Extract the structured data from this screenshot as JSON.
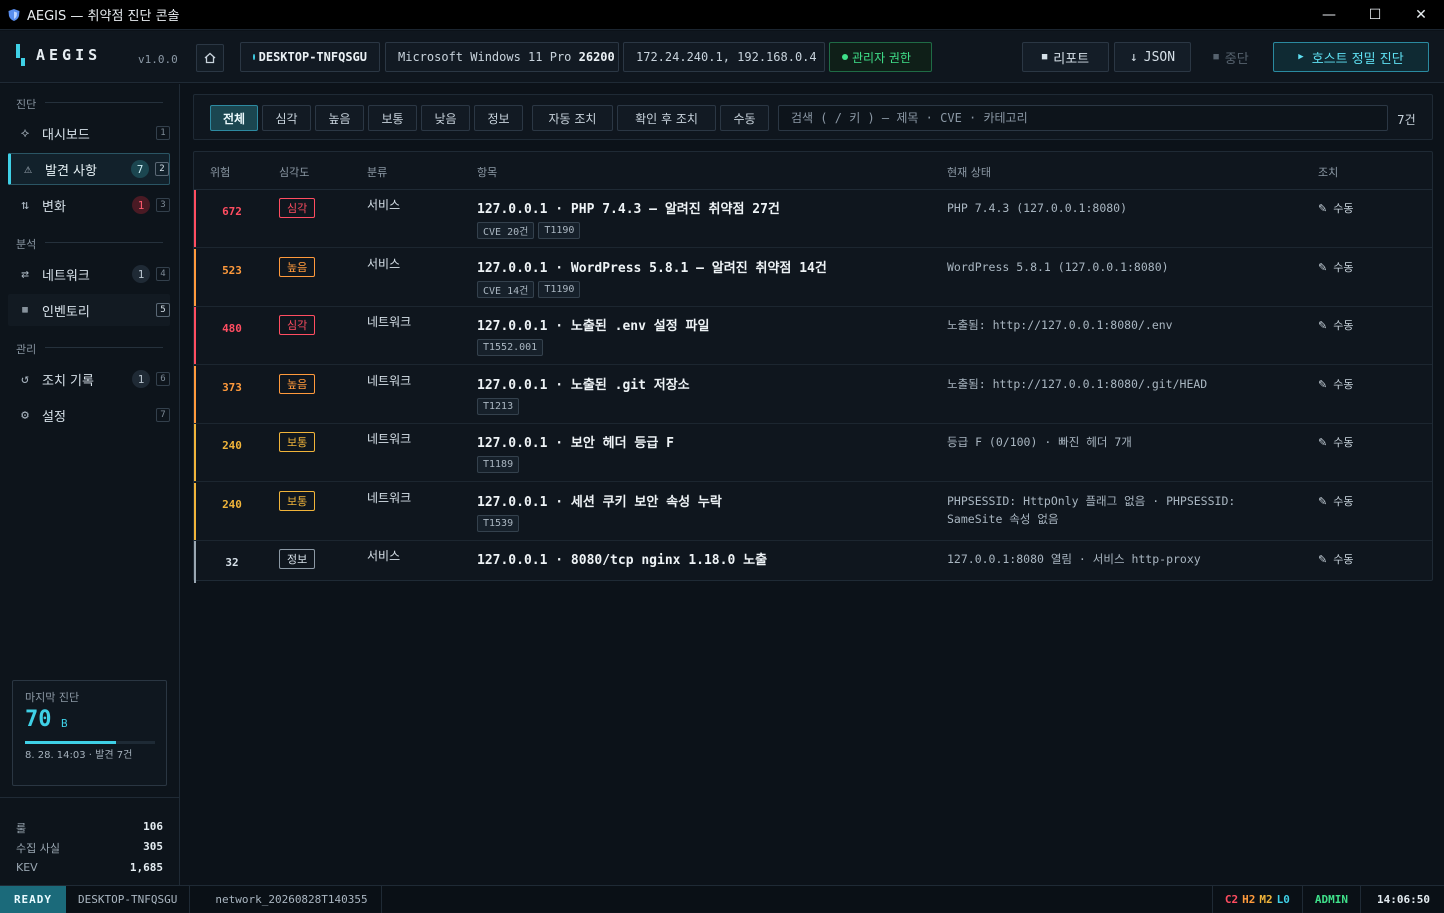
{
  "window": {
    "title": "AEGIS — 취약점 진단 콘솔",
    "minimize": "—",
    "maximize": "☐",
    "close": "✕"
  },
  "header": {
    "brand": "AEGIS",
    "version": "v1.0.0",
    "host": "DESKTOP-TNFQSGU",
    "os_name": "Microsoft Windows 11 Pro",
    "os_build": "26200",
    "ips": "172.24.240.1, 192.168.0.4",
    "admin": "관리자 권한",
    "report_button": "리포트",
    "json_button": "JSON",
    "stop_button": "중단",
    "scan_button": "호스트 정밀 진단"
  },
  "sidebar": {
    "sections": [
      {
        "label": "진단"
      },
      {
        "label": "분석"
      },
      {
        "label": "관리"
      }
    ],
    "items": [
      {
        "label": "대시보드",
        "icon": "diamond-icon",
        "count": "",
        "key": "1"
      },
      {
        "label": "발견 사항",
        "icon": "warning-icon",
        "count": "7",
        "key": "2"
      },
      {
        "label": "변화",
        "icon": "arrows-updown-icon",
        "count": "1",
        "key": "3"
      },
      {
        "label": "네트워크",
        "icon": "arrows-swap-icon",
        "count": "1",
        "key": "4"
      },
      {
        "label": "인벤토리",
        "icon": "inventory-icon",
        "count": "",
        "key": "5"
      },
      {
        "label": "조치 기록",
        "icon": "history-icon",
        "count": "1",
        "key": "6"
      },
      {
        "label": "설정",
        "icon": "gear-icon",
        "count": "",
        "key": "7"
      }
    ],
    "last_scan": {
      "title": "마지막 진단",
      "score": "70",
      "grade": "B",
      "progress": 0.7,
      "meta": "8. 28. 14:03 · 발견 7건"
    },
    "stats": [
      {
        "label": "룰",
        "value": "106"
      },
      {
        "label": "수집 사실",
        "value": "305"
      },
      {
        "label": "KEV",
        "value": "1,685"
      }
    ]
  },
  "filters": {
    "tabs": [
      "전체",
      "심각",
      "높음",
      "보통",
      "낮음",
      "정보",
      "자동 조치",
      "확인 후 조치",
      "수동"
    ],
    "active": 0,
    "search_placeholder": "검색 ( / 키 ) — 제목 · CVE · 카테고리",
    "count": "7건"
  },
  "table": {
    "headers": {
      "risk": "위험",
      "severity": "심각도",
      "category": "분류",
      "item": "항목",
      "status": "현재 상태",
      "action": "조치"
    },
    "rows": [
      {
        "risk": "672",
        "severity": "심각",
        "level": "critical",
        "category": "서비스",
        "title": "127.0.0.1 · PHP 7.4.3 — 알려진 취약점 27건",
        "tags": [
          "CVE 20건",
          "T1190"
        ],
        "status": "PHP 7.4.3 (127.0.0.1:8080)",
        "action": "수동"
      },
      {
        "risk": "523",
        "severity": "높음",
        "level": "high",
        "category": "서비스",
        "title": "127.0.0.1 · WordPress 5.8.1 — 알려진 취약점 14건",
        "tags": [
          "CVE 14건",
          "T1190"
        ],
        "status": "WordPress 5.8.1 (127.0.0.1:8080)",
        "action": "수동"
      },
      {
        "risk": "480",
        "severity": "심각",
        "level": "critical",
        "category": "네트워크",
        "title": "127.0.0.1 · 노출된 .env 설정 파일",
        "tags": [
          "T1552.001"
        ],
        "status": "노출됨: http://127.0.0.1:8080/.env",
        "action": "수동"
      },
      {
        "risk": "373",
        "severity": "높음",
        "level": "high",
        "category": "네트워크",
        "title": "127.0.0.1 · 노출된 .git 저장소",
        "tags": [
          "T1213"
        ],
        "status": "노출됨: http://127.0.0.1:8080/.git/HEAD",
        "action": "수동"
      },
      {
        "risk": "240",
        "severity": "보통",
        "level": "medium",
        "category": "네트워크",
        "title": "127.0.0.1 · 보안 헤더 등급 F",
        "tags": [
          "T1189"
        ],
        "status": "등급 F (0/100) · 빠진 헤더 7개",
        "action": "수동"
      },
      {
        "risk": "240",
        "severity": "보통",
        "level": "medium",
        "category": "네트워크",
        "title": "127.0.0.1 · 세션 쿠키 보안 속성 누락",
        "tags": [
          "T1539"
        ],
        "status": "PHPSESSID: HttpOnly 플래그 없음 · PHPSESSID: SameSite 속성 없음",
        "action": "수동"
      },
      {
        "risk": "32",
        "severity": "정보",
        "level": "info",
        "category": "서비스",
        "title": "127.0.0.1 · 8080/tcp nginx 1.18.0 노출",
        "tags": [],
        "status": "127.0.0.1:8080 열림 · 서비스 http-proxy",
        "action": "수동"
      }
    ]
  },
  "statusbar": {
    "ready": "READY",
    "host": "DESKTOP-TNFQSGU",
    "session": "network_20260828T140355",
    "counts": [
      {
        "label": "C2",
        "color": "#ff4d61"
      },
      {
        "label": "H2",
        "color": "#ff9a3c"
      },
      {
        "label": "M2",
        "color": "#f0b43a"
      },
      {
        "label": "L0",
        "color": "#3fd0e6"
      }
    ],
    "role": "ADMIN",
    "time": "14:06:50"
  },
  "colors": {
    "critical": "#ff4d61",
    "high": "#ff9a3c",
    "medium": "#f0b43a",
    "info": "#9aa7b2",
    "accent": "#3fd0e6"
  }
}
